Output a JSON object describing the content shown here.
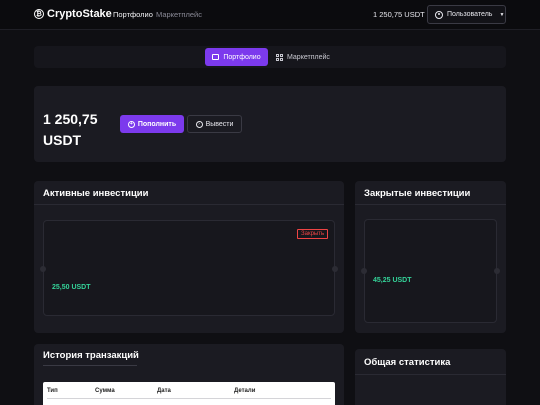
{
  "navbar": {
    "brand": "CryptoStake",
    "brand_icon": "₿",
    "links": [
      "Портфолио",
      "Маркетплейс"
    ],
    "balance": "1 250,75 USDT",
    "user_label": "Пользователь"
  },
  "tabs": {
    "portfolio": "Портфолио",
    "marketplace": "Маркетплейс"
  },
  "balance_card": {
    "amount": "1 250,75 USDT",
    "deposit_label": "Пополнить",
    "withdraw_label": "Вывести"
  },
  "active": {
    "title": "Активные инвестиции",
    "amount": "25,50 USDT",
    "close_label": "Закрыть"
  },
  "closed": {
    "title": "Закрытые инвестиции",
    "amount": "45,25 USDT"
  },
  "history": {
    "title": "История транзакций",
    "columns": [
      "Тип",
      "Сумма",
      "Дата",
      "Детали"
    ]
  },
  "stats": {
    "title": "Общая статистика"
  },
  "colors": {
    "accent": "#7c3aed",
    "positive": "#34d399",
    "danger": "#ef4444"
  }
}
